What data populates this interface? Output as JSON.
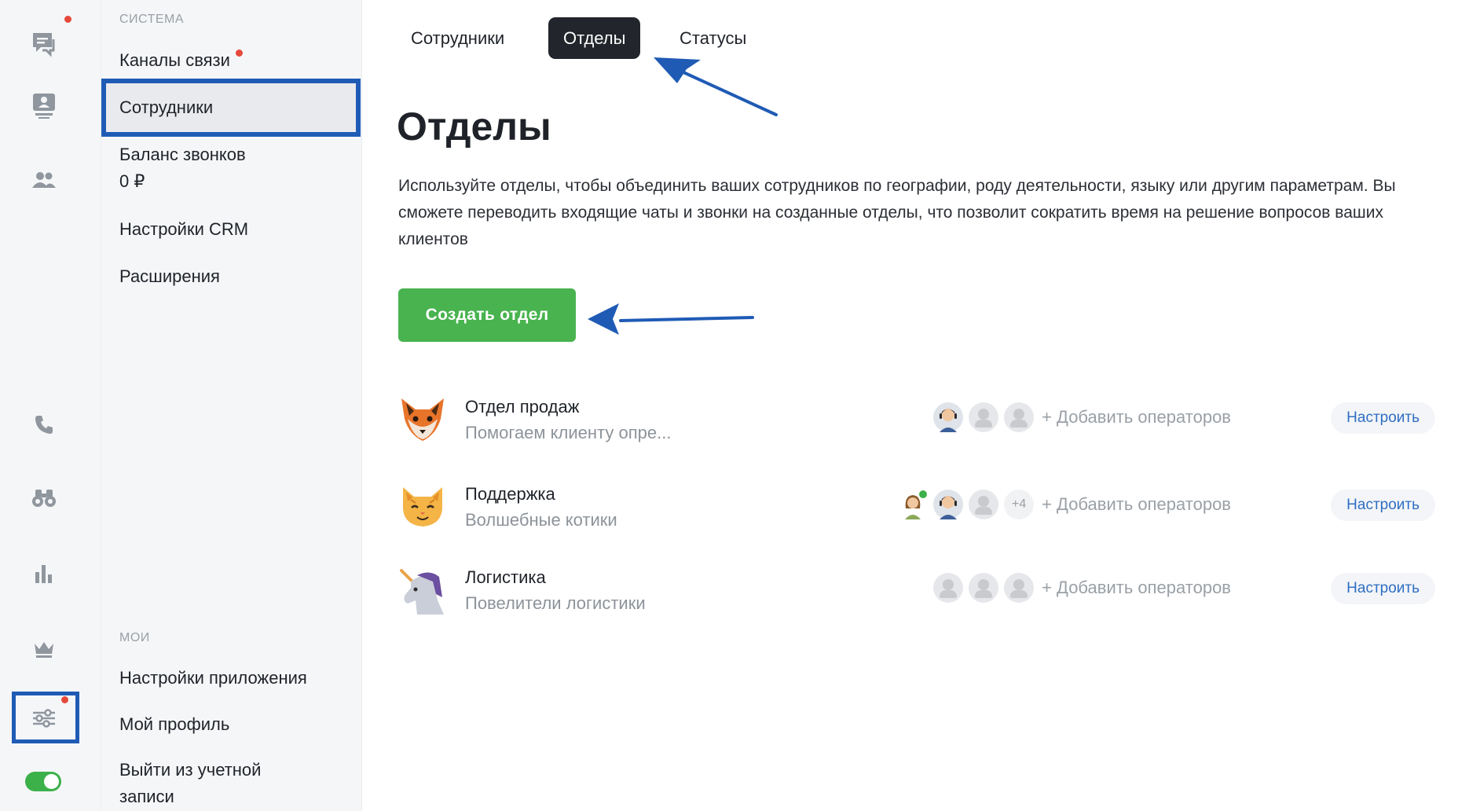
{
  "sidebar_icons": {
    "chats": "chat-icon",
    "visitors": "visitor-icon",
    "team": "team-icon",
    "calls": "phone-icon",
    "monitoring": "binoculars-icon",
    "stats": "bar-chart-icon",
    "premium": "crown-icon",
    "settings": "sliders-icon"
  },
  "menu": {
    "system_section": "Система",
    "items": {
      "channels": "Каналы связи",
      "employees": "Сотрудники",
      "balance": "Баланс звонков",
      "balance_value": "0 ₽",
      "crm": "Настройки CRM",
      "extensions": "Расширения"
    },
    "my_section": "Мои",
    "my_items": {
      "app_settings": "Настройки приложения",
      "profile": "Мой профиль",
      "logout_line1": "Выйти из учетной",
      "logout_line2": "записи"
    }
  },
  "tabs": {
    "employees": "Сотрудники",
    "departments": "Отделы",
    "statuses": "Статусы"
  },
  "page": {
    "title": "Отделы",
    "description": "Используйте отделы, чтобы объединить ваших сотрудников по географии, роду деятельности, языку или другим параметрам. Вы сможете переводить входящие чаты и звонки на созданные отделы, что позволит сократить время на решение вопросов ваших клиентов",
    "create_button": "Создать отдел"
  },
  "departments": [
    {
      "name": "Отдел продаж",
      "description": "Помогаем клиенту опре...",
      "icon": "fox-icon",
      "add_operators": "+ Добавить операторов",
      "configure": "Настроить"
    },
    {
      "name": "Поддержка",
      "description": "Волшебные котики",
      "icon": "cat-icon",
      "more_count": "+4",
      "add_operators": "+ Добавить операторов",
      "configure": "Настроить"
    },
    {
      "name": "Логистика",
      "description": "Повелители логистики",
      "icon": "unicorn-icon",
      "add_operators": "+ Добавить операторов",
      "configure": "Настроить"
    }
  ],
  "colors": {
    "accent_green": "#48b34f",
    "highlight_blue": "#1f5bb5",
    "link_blue": "#2f6ec2",
    "notification_red": "#e5493a"
  }
}
